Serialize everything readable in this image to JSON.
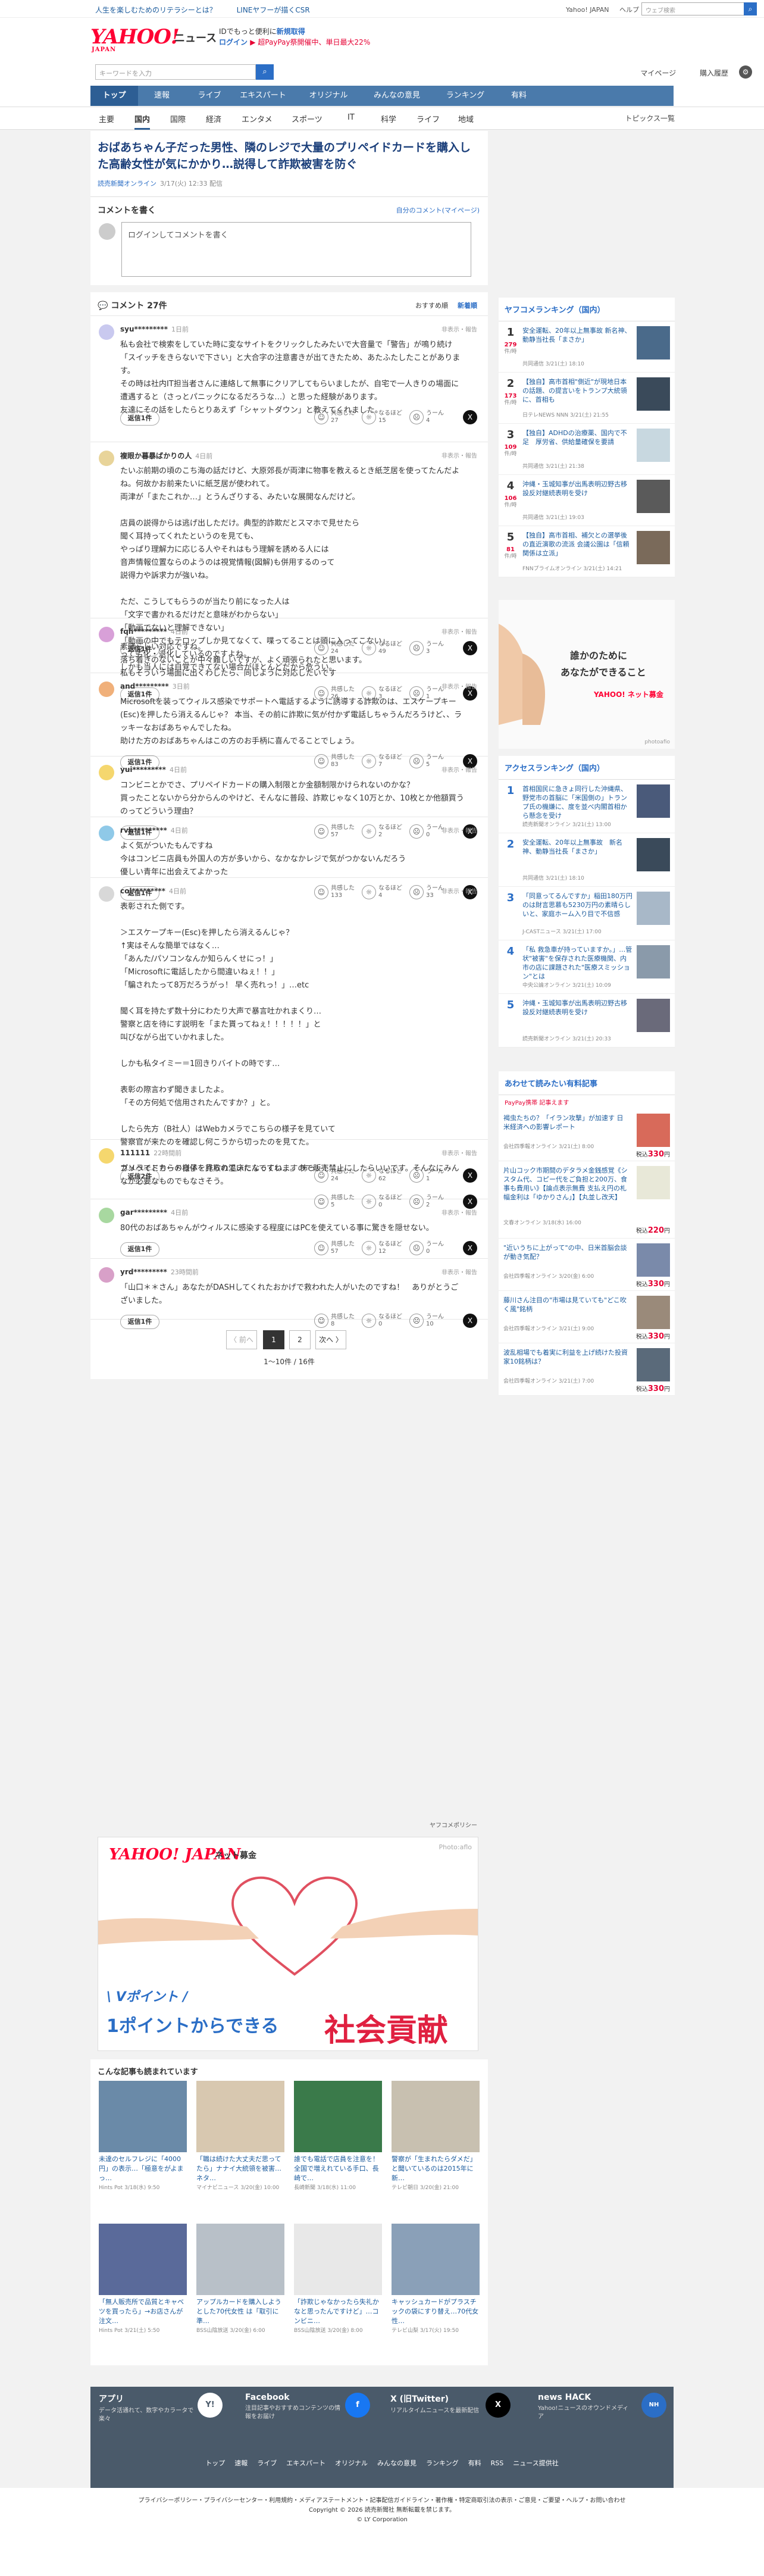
{
  "topbar": {
    "promo1": "人生を楽しむためのリテラシーとは？",
    "promo2": "LINEヤフーが描くCSR",
    "yahoo_japan": "Yahoo! JAPAN",
    "help": "ヘルプ",
    "search_placeholder": "ウェブ検索",
    "search_suffix": "🔍 木事前作"
  },
  "header": {
    "logo": "YAHOO!",
    "logo_sub": "JAPAN",
    "news": "ニュース",
    "notice1": "IDでもっと便利に",
    "notice1_link": "新規取得",
    "login": "ログイン",
    "notice2": "▶ 超PayPay祭開催中、単日最大22%"
  },
  "search": {
    "placeholder": "キーワードを入力",
    "mypage": "マイページ",
    "purchased": "購入履歴"
  },
  "nav1": [
    "トップ",
    "速報",
    "ライブ",
    "エキスパート",
    "オリジナル",
    "みんなの意見",
    "ランキング",
    "有料"
  ],
  "nav2": [
    "主要",
    "国内",
    "国際",
    "経済",
    "エンタメ",
    "スポーツ",
    "IT",
    "科学",
    "ライフ",
    "地域"
  ],
  "topics_list": "トピックス一覧",
  "article": {
    "title": "おばあちゃん子だった男性、隣のレジで大量のプリペイドカードを購入した高齢女性が気にかかり…説得して詐欺被害を防ぐ",
    "source": "読売新聞オンライン",
    "date": "3/17(火) 12:33 配信"
  },
  "comment_box": {
    "title": "コメントを書く",
    "mine": "自分のコメント(マイページ)",
    "placeholder": "ログインしてコメントを書く"
  },
  "list": {
    "title": "コメント 27件",
    "sort1": "おすすめ順",
    "sort2": "新着順"
  },
  "labels": {
    "reply": "返信",
    "kyokan": "共感した",
    "naruhodo": "なるほど",
    "uun": "うーん",
    "report": "非表示・報告"
  },
  "comments": [
    {
      "user": "syu*********",
      "time": "1日前",
      "text": "私も会社で検索をしていた時に変なサイトをクリックしたみたいで大音量で「警告」が鳴り続け「スイッチをきらないで下さい」と大合字の注意書きが出てきたため、あたふたしたことがあります。\nその時は社内IT担当者さんに連絡して無事にクリアしてもらいましたが、自宅で一人きりの場面に遭遇すると（さっとパニックになるだろうな…）と思った経験があります。\n友達にその話をしたらとりあえず「シャットダウン」と教えてくれました。",
      "replies": "返信1件",
      "c1": "27",
      "c2": "15",
      "c3": "4"
    },
    {
      "user": "複眼か暮暴ばかりの人",
      "time": "4日前",
      "text": "たいぶ前期の頃のこち海の話だけど、大原郊長が両津に物事を教えるとき紙芝居を使ってたんだよね。何故かお前来たいに紙芝居が使われて。\n両津が「またこれか…」とうんざりする、みたいな展開なんだけど。\n\n店員の説得からは逃げ出しただけ。典型的詐欺だとスマホで見せたら\n聞く耳持ってくれたというのを見ても、\nやっぱり理解力に応じる人やそれはもう理解を誘める人には\n音声情報位置ならのようのは視覚情報(図解)も併用するのって\n説得力や訴求力が強いね。\n\nただ、こうしてもらうのが当たり前になった人は\n「文字で書かれるだけだと意味がわからない」\n「動画でないと理解できない」\n「動画の中でもテロップしか見てなくて、喋ってることは頭に入ってこない」\nって劣化・退化しているのですよね。\nしかも当人には自覚できてない場合がほとんどだから危うい。",
      "replies": "返信1件",
      "c1": "24",
      "c2": "49",
      "c3": "3"
    },
    {
      "user": "fqh*********",
      "time": "4日前",
      "text": "素晴らしい対応ですね。\n落ち着きのないことが中々難しいですが、よく頑張られたと思います。\n私もそういう場面に出くわしたら、同じように対応したいです",
      "replies": "返信1件",
      "c1": "26",
      "c2": "3",
      "c3": "1"
    },
    {
      "user": "and*********",
      "time": "3日前",
      "text": "Microsoftを装ってウィルス感染でサポートへ電話するように誘導する詐欺のは、エスケープキー(Esc)を押したら消えるんじゃ？ 本当、その前に詐欺に気が付かず電話しちゃうんだろうけど、、ラッキーなおばあちゃんでしたね。\n助けた方のおばあちゃんはこの方のお手柄に喜んでることでしょう。",
      "replies": "返信1件",
      "c1": "83",
      "c2": "7",
      "c3": "5"
    },
    {
      "user": "yui*********",
      "time": "4日前",
      "text": "コンビニとかでさ、プリペイドカードの購入制限とか金額制限かけられないのかな？\n買ったことないから分からんのやけど、そんなに普段、詐欺じゃなく10万とか、10枚とか他額買うのってどういう理由？",
      "replies": "返信1件",
      "c1": "57",
      "c2": "2",
      "c3": "0"
    },
    {
      "user": "rvh*********",
      "time": "4日前",
      "text": "よく気がついたもんですね\n今はコンビニ店員も外国人の方が多いから、なかなかレジで気がつかないんだろう\n優しい青年に出会えてよかった",
      "replies": "返信1件",
      "c1": "133",
      "c2": "4",
      "c3": "33"
    },
    {
      "user": "col*********",
      "time": "4日前",
      "text": "表彰された側です。\n\n＞エスケープキー(Esc)を押したら消えるんじゃ？\n↑実はそんな簡単ではなく…\n「あんた/パソコンなんか知らんくせにっ！」\n「Microsoftに電話したから間違いねぇ！！」\n「騙されたって8万だろうがっ！ 早く売れっ！」…etc\n\n聞く耳を持たず数十分にわたり大声で暴言吐かれまくり…\n警察と店を待にす説明を「また貰ってねぇ！！！！！」と\n叫びながら出ていかれました。\n\nしかも私タイミー＝1回きりバイトの時です…\n\n表彰の際言わず聞きましたよ。\n「その方何処で信用されたんですか？」と。\n\nしたら先方（B社人）はWebカメラでこちらの様子を見ていて\n警察官が来たのを確認し何こうから切ったのを見てた。\n\nカメラでこちらの様子を見られていたんですね…。 怖っ！！",
      "replies": "返信2件",
      "c1": "24",
      "c2": "62",
      "c3": "1"
    },
    {
      "user": "111111",
      "time": "22時間前",
      "text": "プリペイドカード自体を詐欺の温床になっていますので販売禁止にしたらいいです。そんなにみんなが必要なものでもなさそう。",
      "replies": "",
      "c1": "5",
      "c2": "0",
      "c3": "2"
    },
    {
      "user": "gar*********",
      "time": "4日前",
      "text": "80代のおばあちゃんがウィルスに感染する程度にはPCを使えている事に驚きを隠せない。",
      "replies": "返信1件",
      "c1": "57",
      "c2": "12",
      "c3": "0"
    },
    {
      "user": "yrd*********",
      "time": "23時間前",
      "text": "「山口＊＊さん」あなたがDASHしてくれたおかげで救われた人がいたのですね！　ありがとうございました。",
      "replies": "返信1件",
      "c1": "8",
      "c2": "0",
      "c3": "10"
    }
  ],
  "pager": {
    "prev": "〈 前へ",
    "p1": "1",
    "p2": "2",
    "next": "次へ 〉",
    "count": "1〜10件 / 16件"
  },
  "policy": "ヤフコメポリシー",
  "banner": {
    "logo": "YAHOO! JAPAN",
    "tag": "ネット募金",
    "photo": "Photo:aflo",
    "line1": "\\ Vポイント /",
    "line2": "1ポイントからできる",
    "line3": "社会貢献"
  },
  "related": {
    "title": "こんな記事も読まれています",
    "items": [
      {
        "t": "未達のセルフレジに「4000円」の表示…「極意をがよまっ…",
        "s": "Hints Pot",
        "d": "3/18(水) 9:50"
      },
      {
        "t": "「職は続けた大丈夫だ思ってたら」ナナイ大統領を被害…ネタ…",
        "s": "マイナビニュース",
        "d": "3/20(金) 10:00"
      },
      {
        "t": "誰でも電話で店員を注意を！全国で増えれている手口、長崎で…",
        "s": "長崎新聞",
        "d": "3/18(水) 11:00"
      },
      {
        "t": "警察が「生まれたらダメだ」と聞いているのは2015年に新…",
        "s": "テレビ朝日",
        "d": "3/20(金) 21:00"
      },
      {
        "t": "「無人販売所で品質とキャベツを買ったら」→お店さんが注文…",
        "s": "Hints Pot",
        "d": "3/21(土) 5:50"
      },
      {
        "t": "アップルカードを購入しようとした70代女性 は「取引に準…",
        "s": "BSS山陰放送",
        "d": "3/20(金) 6:00"
      },
      {
        "t": "「詐欺じゃなかったら失礼かなと思ったんですけど」…コンビニ…",
        "s": "BSS山陰放送",
        "d": "3/20(金) 8:00"
      },
      {
        "t": "キャッシュカードがプラスチックの袋にすり替え…70代女性…",
        "s": "テレビ山梨",
        "d": "3/17(火) 19:50"
      }
    ]
  },
  "ranking": {
    "title": "ヤフコメランキング（国内）",
    "items": [
      {
        "no": "1",
        "val": "279",
        "unit": "件/時",
        "t": "安全運転、20年以上無事故 新名神、動静当社長「まさか」",
        "s": "共同通信 3/21(土) 18:10"
      },
      {
        "no": "2",
        "val": "173",
        "unit": "件/時",
        "t": "【独自】高市首相\"側近\"が現地日本の話題、の提言いをトランプ大統領に、首相も",
        "s": "日テレNEWS NNN 3/21(土) 21:55"
      },
      {
        "no": "3",
        "val": "109",
        "unit": "件/時",
        "t": "【独自】ADHDの治療薬、国内で不足　厚労省、供給量確保を要請",
        "s": "共同通信 3/21(土) 21:38"
      },
      {
        "no": "4",
        "val": "106",
        "unit": "件/時",
        "t": "沖縄・玉城知事が出馬表明辺野古移設反対継続表明を受け",
        "s": "共同通信 3/21(土) 19:03"
      },
      {
        "no": "5",
        "val": "81",
        "unit": "件/時",
        "t": "【独自】高市首相、補欠との選挙後の直近演歌の流派 会議公園は「信頼関係は立派」",
        "s": "FNNプライムオンライン 3/21(土) 14:21"
      }
    ]
  },
  "ad": {
    "l1": "誰かのために",
    "l2": "あなたができること",
    "brand": "YAHOO! ネット募金",
    "credit": "photoafio"
  },
  "access": {
    "title": "アクセスランキング（国内）",
    "items": [
      {
        "no": "1",
        "t": "首相国民に急きょ同行した沖縄県、野党市の首脳に「米国側の」トランプ氏の機嫌に、度を並べ内閣首相から懸念を受け",
        "s": "読売新聞オンライン 3/21(土) 13:00"
      },
      {
        "no": "2",
        "t": "安全運転、20年以上無事故　新名神、動静当社長「まさか」",
        "s": "共同通信 3/21(土) 18:10"
      },
      {
        "no": "3",
        "t": "「同意ってるんですか」稲田180万円のは財言思慕も5230万円の素晴らしいと、家庭ホーム入り目で不信感",
        "s": "J-CASTニュース 3/21(土) 17:00"
      },
      {
        "no": "4",
        "t": "「私 救急車が持っていますか。」…管状\"被害\"を保存された医療機関、内市の店に課題された\"医療スミッション\"とは",
        "s": "中央公論オンライン 3/21(土) 10:09"
      },
      {
        "no": "5",
        "t": "沖縄・玉城知事が出馬表明辺野古移設反対継続表明を受け",
        "s": "読売新聞オンライン 3/21(土) 20:33"
      }
    ]
  },
  "premium": {
    "title": "あわせて読みたい有料記事",
    "sub": "PayPay携帯 記事えます",
    "items": [
      {
        "t": "褐虫たちの？「イラン攻撃」が加速す 日米経済への影響レポート",
        "s": "会社四季報オンライン 3/21(土) 8:00",
        "pr": "330",
        "unit": "円"
      },
      {
        "t": "片山コック市期間のデタラメ金銭感覚《シスタム代、コピー代をご負担と200万、食事も費用い》【論点表示無費 支払え円の札幅金利は「ゆかりさん」】【丸並し改天】",
        "s": "文春オンライン 3/18(水) 16:00",
        "pr": "220",
        "unit": "円"
      },
      {
        "t": "\"近いうちに上がって\"の中、日米首脳会談が動き気配？",
        "s": "会社四季報オンライン 3/20(金) 6:00",
        "pr": "330",
        "unit": "円"
      },
      {
        "t": "藤川さん注目の\"市場は見ていても\"どこ吹く風\"銘柄",
        "s": "会社四季報オンライン 3/21(土) 9:00",
        "pr": "330",
        "unit": "円"
      },
      {
        "t": "波乱相場でも着実に利益を上げ続けた投資家10銘柄は？",
        "s": "会社四季報オンライン 3/21(土) 7:00",
        "pr": "330",
        "unit": "円"
      }
    ]
  },
  "footer": {
    "app": "アプリ",
    "app_d": "データ活通れて、数字やカラータで楽々",
    "fb": "Facebook",
    "fb_d": "注目記事やおすすめコンテンツの情報をお届け",
    "x": "X (旧Twitter)",
    "x_d": "リアルタイムニュースを最新配信",
    "hack": "news HACK",
    "hack_d": "Yahoo!ニュースのオウンドメディア",
    "nav": [
      "トップ",
      "速報",
      "ライブ",
      "エキスパート",
      "オリジナル",
      "みんなの意見",
      "ランキング",
      "有料",
      "RSS",
      "ニュース提供社"
    ]
  },
  "bottom": {
    "l1": "プライバシーポリシー・プライバシーセンター・利用規約・メディアステートメント・記事配信ガイドライン・著作権・特定商取引法の表示・ご意見・ご要望・ヘルプ・お問い合わせ",
    "l2": "Copyright © 2026 読売新聞社 無断転載を禁じます。",
    "l3": "© LY Corporation"
  }
}
